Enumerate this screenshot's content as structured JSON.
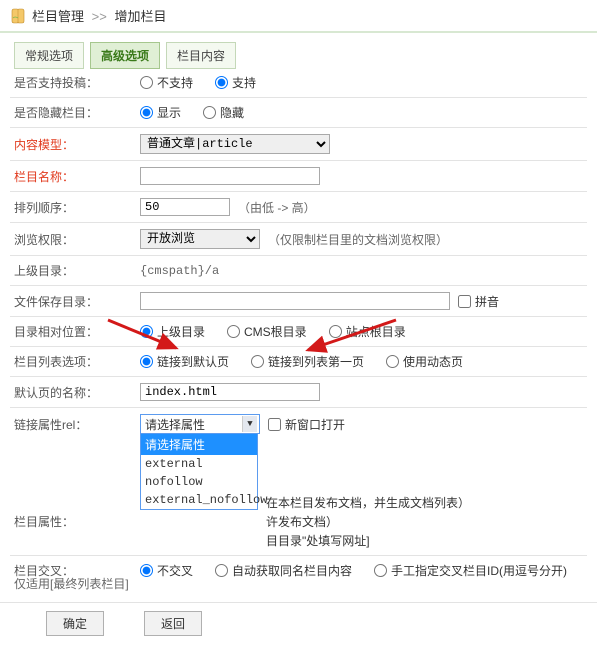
{
  "breadcrumb": {
    "a": "栏目管理",
    "b": "增加栏目"
  },
  "tabs": {
    "t1": "常规选项",
    "t2": "高级选项",
    "t3": "栏目内容"
  },
  "labels": {
    "contribute": "是否支持投稿：",
    "hide": "是否隐藏栏目：",
    "model": "内容模型：",
    "name": "栏目名称：",
    "order": "排列顺序：",
    "browse": "浏览权限：",
    "parent": "上级目录：",
    "savepath": "文件保存目录：",
    "relpos": "目录相对位置：",
    "listopt": "栏目列表选项：",
    "defname": "默认页的名称：",
    "linkrel": "链接属性rel：",
    "colattr": "栏目属性：",
    "cross": "栏目交叉：",
    "cross_sub": "仅适用[最终列表栏目]"
  },
  "radios": {
    "nosupport": "不支持",
    "support": "支持",
    "show": "显示",
    "hideopt": "隐藏",
    "parentdir": "上级目录",
    "cmsroot": "CMS根目录",
    "siteroot": "站点根目录",
    "linkdefault": "链接到默认页",
    "linkfirst": "链接到列表第一页",
    "usedyn": "使用动态页",
    "nocross": "不交叉",
    "autocross": "自动获取同名栏目内容",
    "manualcross": "手工指定交叉栏目ID(用逗号分开)"
  },
  "values": {
    "model": "普通文章|article",
    "order": "50",
    "order_hint": "（由低 -> 高）",
    "browse": "开放浏览",
    "browse_hint": "（仅限制栏目里的文档浏览权限）",
    "parent": "{cmspath}/a",
    "defname": "index.html",
    "rel_ph": "请选择属性",
    "newwin": "新窗口打开",
    "pinyin": "拼音"
  },
  "rel_opts": {
    "o1": "请选择属性",
    "o2": "external",
    "o3": "nofollow",
    "o4": "external_nofollow"
  },
  "colattr": {
    "a": "在本栏目发布文档，并生成文档列表）",
    "b": "许发布文档）",
    "c": "目目录\"处填写网址]"
  },
  "btns": {
    "ok": "确定",
    "back": "返回"
  }
}
